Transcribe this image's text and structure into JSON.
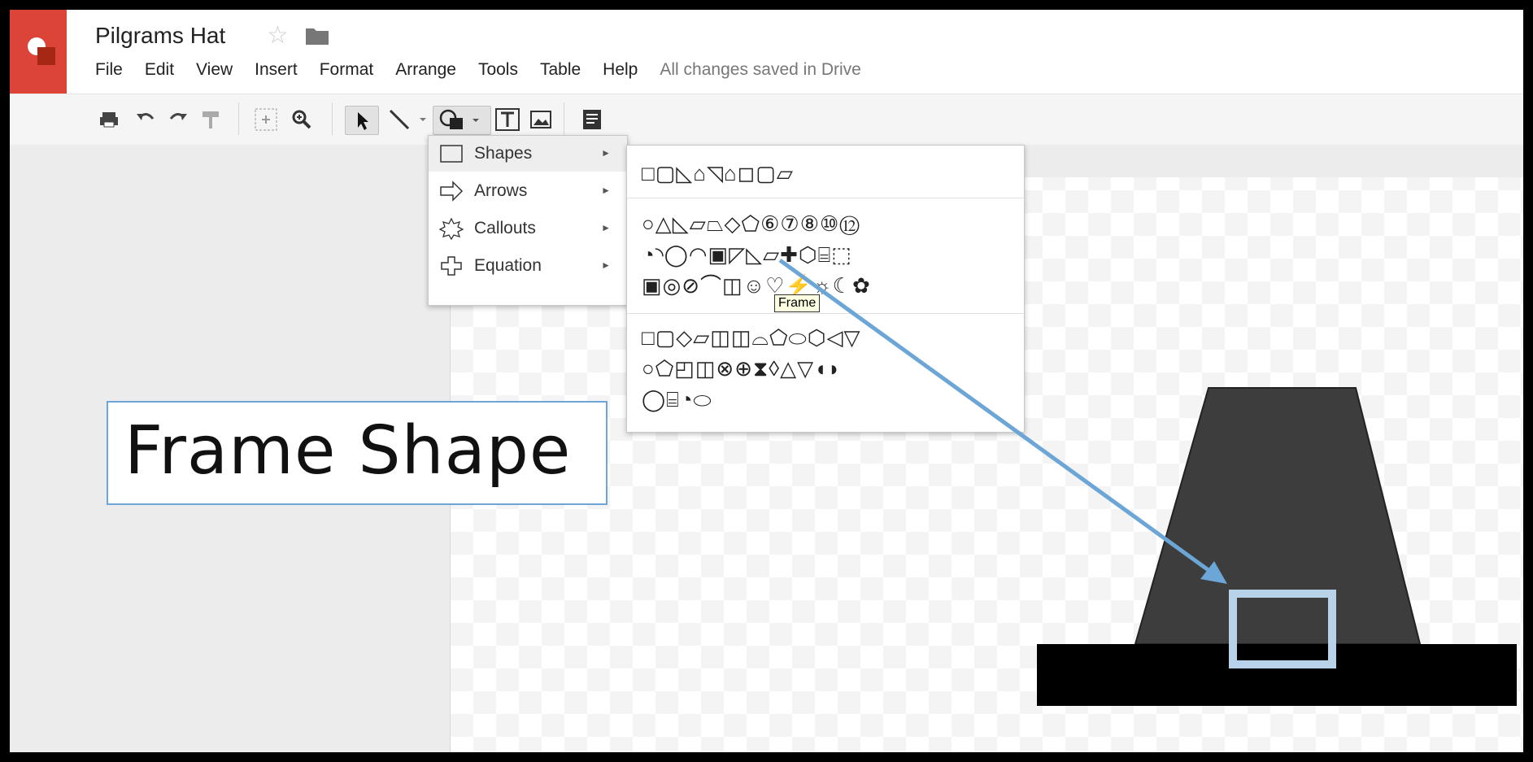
{
  "app": {
    "title": "Pilgrams Hat",
    "star_glyph": "☆",
    "menu": [
      "File",
      "Edit",
      "View",
      "Insert",
      "Format",
      "Arrange",
      "Tools",
      "Table",
      "Help"
    ],
    "save_status": "All changes saved in Drive"
  },
  "toolbar": {
    "icons": [
      "print-icon",
      "undo-icon",
      "redo-icon",
      "paint-format-icon",
      "zoom-fit-icon",
      "zoom-icon",
      "select-icon",
      "line-icon",
      "shape-icon",
      "text-box-icon",
      "image-icon",
      "comment-icon"
    ]
  },
  "shape_menu": {
    "items": [
      {
        "label": "Shapes",
        "icon": "rectangle-icon"
      },
      {
        "label": "Arrows",
        "icon": "arrow-icon"
      },
      {
        "label": "Callouts",
        "icon": "callout-icon"
      },
      {
        "label": "Equation",
        "icon": "plus-icon"
      }
    ],
    "submenu_arrow": "►"
  },
  "palette": {
    "rows": [
      "□▢◺⌂◹⌂◻▢▱",
      "○△◺▱⏢◇⬠⑥⑦⑧⑩⑫",
      "◔◝◯◠▣◸◺▱✚⬡⌸⬚",
      "▣◎⊘⌒◫☺♡⚡☼☾✿",
      "□▢◇▱◫◫⌓⬠⬭⬡◁▽",
      "○⬠◰◫⊗⊕⧗◊△▽◖◗",
      "◯⌸◔⬭"
    ],
    "tooltip": "Frame"
  },
  "annotation": {
    "label": "Frame Shape",
    "colors": {
      "box_border": "#6ca6d6",
      "arrow": "#6ca6d6"
    }
  },
  "colors": {
    "brand_red": "#db4437",
    "hat_body": "#3d3d3d",
    "hat_brim": "#000000",
    "buckle": "#b8d2ea"
  }
}
